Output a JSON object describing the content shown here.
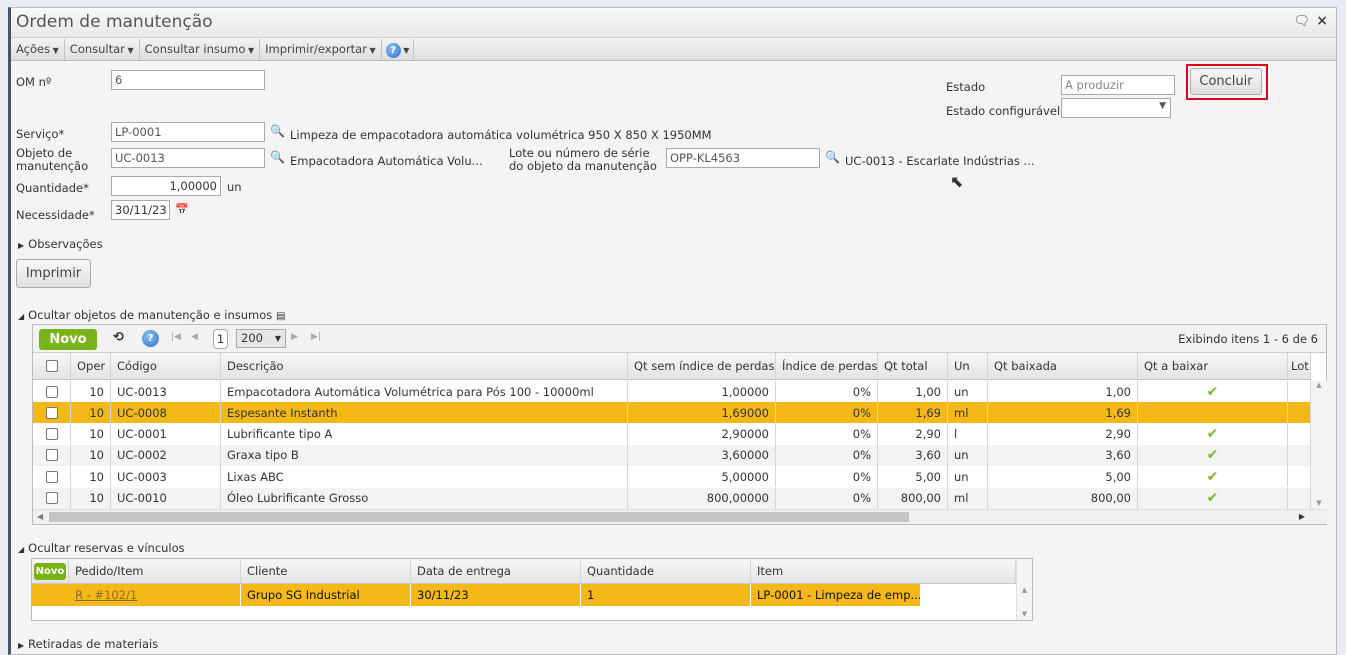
{
  "window": {
    "title": "Ordem de manutenção"
  },
  "menu": [
    "Ações",
    "Consultar",
    "Consultar insumo",
    "Imprimir/exportar"
  ],
  "help_label": "?",
  "form": {
    "om_label": "OM nº",
    "om_value": "6",
    "estado_label": "Estado",
    "estado_value": "A produzir",
    "estado_conf_label": "Estado configurável",
    "estado_conf_value": "",
    "concluir": "Concluir",
    "servico_label": "Serviço*",
    "servico_value": "LP-0001",
    "servico_desc": "Limpeza de empacotadora automática volumétrica 950 X 850 X 1950MM",
    "objeto_label": "Objeto de manutenção",
    "objeto_value": "UC-0013",
    "objeto_desc": "Empacotadora Automática Volu...",
    "lote_label": "Lote ou número de série do objeto da manutenção",
    "lote_value": "OPP-KL4563",
    "lote_desc": "UC-0013 - Escarlate Indústrias ...",
    "qtd_label": "Quantidade*",
    "qtd_value": "1,00000",
    "qtd_unit": "un",
    "nec_label": "Necessidade*",
    "nec_value": "30/11/23",
    "obs_label": "Observações",
    "imprimir": "Imprimir"
  },
  "objetos": {
    "section_label": "Ocultar objetos de manutenção e insumos",
    "novo": "Novo",
    "page": "1",
    "page_size": "200",
    "info": "Exibindo itens 1 - 6 de 6",
    "columns": [
      "Oper",
      "Código",
      "Descrição",
      "Qt sem índice de perdas",
      "Índice de perdas",
      "Qt total",
      "Un",
      "Qt baixada",
      "Qt a baixar",
      "Lot"
    ],
    "rows": [
      {
        "oper": "10",
        "codigo": "UC-0013",
        "descricao": "Empacotadora Automática Volumétrica para Pós 100 - 10000ml",
        "qt_sem": "1,00000",
        "indice": "0%",
        "qt_total": "1,00",
        "un": "un",
        "qt_baixada": "1,00",
        "check": "✔"
      },
      {
        "oper": "10",
        "codigo": "UC-0008",
        "descricao": "Espesante Instanth",
        "qt_sem": "1,69000",
        "indice": "0%",
        "qt_total": "1,69",
        "un": "ml",
        "qt_baixada": "1,69",
        "check": ""
      },
      {
        "oper": "10",
        "codigo": "UC-0001",
        "descricao": "Lubrificante tipo A",
        "qt_sem": "2,90000",
        "indice": "0%",
        "qt_total": "2,90",
        "un": "l",
        "qt_baixada": "2,90",
        "check": "✔"
      },
      {
        "oper": "10",
        "codigo": "UC-0002",
        "descricao": "Graxa tipo B",
        "qt_sem": "3,60000",
        "indice": "0%",
        "qt_total": "3,60",
        "un": "un",
        "qt_baixada": "3,60",
        "check": "✔"
      },
      {
        "oper": "10",
        "codigo": "UC-0003",
        "descricao": "Lixas ABC",
        "qt_sem": "5,00000",
        "indice": "0%",
        "qt_total": "5,00",
        "un": "un",
        "qt_baixada": "5,00",
        "check": "✔"
      },
      {
        "oper": "10",
        "codigo": "UC-0010",
        "descricao": "Óleo Lubrificante Grosso",
        "qt_sem": "800,00000",
        "indice": "0%",
        "qt_total": "800,00",
        "un": "ml",
        "qt_baixada": "800,00",
        "check": "✔"
      }
    ]
  },
  "reservas": {
    "section_label": "Ocultar reservas e vínculos",
    "novo": "Novo",
    "columns": [
      "Pedido/Item",
      "Cliente",
      "Data de entrega",
      "Quantidade",
      "Item"
    ],
    "rows": [
      {
        "pedido": "R - #102/1",
        "cliente": "Grupo SG Industrial",
        "data": "30/11/23",
        "quantidade": "1",
        "item": "LP-0001 - Limpeza de emp..."
      }
    ]
  },
  "retiradas_label": "Retiradas de materiais",
  "colors": {
    "selected_row": "#f4b817",
    "novo": "#7ab317",
    "highlight": "#e0001b"
  }
}
